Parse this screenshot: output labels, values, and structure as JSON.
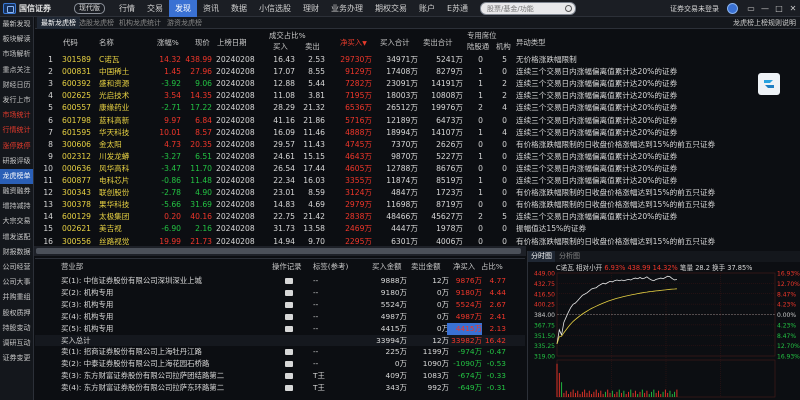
{
  "app": {
    "logo_text": "国信证券",
    "edition": "现代版",
    "menu": [
      "行情",
      "交易",
      "发现",
      "资讯",
      "数据",
      "小信选股",
      "理财",
      "业务办理",
      "期权交易",
      "账户",
      "E苏通"
    ],
    "active_menu_index": 2,
    "search_placeholder": "股票/基金/功能",
    "login_status": "证券交易未登录",
    "window_buttons": [
      "▭",
      "—",
      "□",
      "✕"
    ]
  },
  "sidebar": {
    "items": [
      "最新发现",
      "板块解读",
      "市场解析",
      "重点关注",
      "财经日历",
      "发行上市",
      "市场统计",
      "行情统计",
      "涨停跌停",
      "研报评级",
      "龙虎榜单",
      "融资融券",
      "增持减持",
      "大宗交易",
      "增发送配",
      "财报数据",
      "公司经营",
      "公司大事",
      "并购重组",
      "股权质押",
      "持股变动",
      "调研互动",
      "证券变更"
    ],
    "red_items": [
      6,
      7,
      8
    ],
    "active_index": 10
  },
  "subtabs": {
    "items": [
      "最新龙虎榜",
      "选股龙虎榜",
      "机构龙虎统计",
      "游资龙虎榜"
    ],
    "active_index": 0,
    "right_link": "龙虎榜上榜规则说明"
  },
  "grid": {
    "header_top": {
      "turnover_ratio": "成交占比%",
      "dedicated_seats": "专用席位"
    },
    "header": {
      "num": "",
      "code": "代码",
      "name": "名称",
      "change": "涨幅%",
      "price": "现价",
      "list_date": "上榜日期",
      "buy": "买入",
      "sell": "卖出",
      "net_buy": "净买入",
      "buy_total": "买入合计",
      "sell_total": "卖出合计",
      "hk_connect": "陆股通",
      "institution": "机构",
      "reason": "异动类型"
    },
    "rows": [
      {
        "num": "1",
        "code": "301589",
        "name": "C诺瓦",
        "change": "14.32",
        "price": "438.99",
        "date": "20240208",
        "buy": "16.43",
        "sell": "2.53",
        "net": "29730万",
        "buy_total": "34971万",
        "sell_total": "5241万",
        "hk": "0",
        "inst": "5",
        "reason": "无价格涨跌幅限制",
        "dir": "up"
      },
      {
        "num": "2",
        "code": "000831",
        "name": "中国稀土",
        "change": "1.45",
        "price": "27.96",
        "date": "20240208",
        "buy": "17.07",
        "sell": "8.55",
        "net": "9129万",
        "buy_total": "17408万",
        "sell_total": "8279万",
        "hk": "1",
        "inst": "0",
        "reason": "连续三个交易日内涨幅偏离值累计达20%的证券",
        "dir": "up"
      },
      {
        "num": "3",
        "code": "600392",
        "name": "盛和资源",
        "change": "-3.92",
        "price": "9.06",
        "date": "20240208",
        "buy": "12.88",
        "sell": "5.44",
        "net": "7282万",
        "buy_total": "23091万",
        "sell_total": "14191万",
        "hk": "1",
        "inst": "2",
        "reason": "连续三个交易日内涨幅偏离值累计达20%的证券",
        "dir": "down"
      },
      {
        "num": "4",
        "code": "002625",
        "name": "光启技术",
        "change": "3.54",
        "price": "14.35",
        "date": "20240208",
        "buy": "11.08",
        "sell": "3.81",
        "net": "7195万",
        "buy_total": "18003万",
        "sell_total": "10808万",
        "hk": "1",
        "inst": "2",
        "reason": "连续三个交易日内涨幅偏离值累计达20%的证券",
        "dir": "up"
      },
      {
        "num": "5",
        "code": "600557",
        "name": "康缘药业",
        "change": "-2.71",
        "price": "17.22",
        "date": "20240208",
        "buy": "28.29",
        "sell": "21.32",
        "net": "6536万",
        "buy_total": "26512万",
        "sell_total": "19976万",
        "hk": "2",
        "inst": "4",
        "reason": "连续三个交易日内涨幅偏离值累计达20%的证券",
        "dir": "down"
      },
      {
        "num": "6",
        "code": "601798",
        "name": "蓝科高新",
        "change": "9.97",
        "price": "6.84",
        "date": "20240208",
        "buy": "41.16",
        "sell": "21.86",
        "net": "5716万",
        "buy_total": "12189万",
        "sell_total": "6473万",
        "hk": "0",
        "inst": "0",
        "reason": "连续三个交易日内涨幅偏离值累计达20%的证券",
        "dir": "up"
      },
      {
        "num": "7",
        "code": "601595",
        "name": "华天科技",
        "change": "10.01",
        "price": "8.57",
        "date": "20240208",
        "buy": "16.09",
        "sell": "11.46",
        "net": "4888万",
        "buy_total": "18994万",
        "sell_total": "14107万",
        "hk": "1",
        "inst": "4",
        "reason": "连续三个交易日内涨幅偏离值累计达20%的证券",
        "dir": "up"
      },
      {
        "num": "8",
        "code": "300606",
        "name": "金太阳",
        "change": "4.73",
        "price": "20.35",
        "date": "20240208",
        "buy": "29.57",
        "sell": "11.43",
        "net": "4745万",
        "buy_total": "7370万",
        "sell_total": "2626万",
        "hk": "0",
        "inst": "0",
        "reason": "有价格涨跌幅限制的日收盘价格涨幅达到15%的前五只证券",
        "dir": "up"
      },
      {
        "num": "9",
        "code": "002312",
        "name": "川发龙蟒",
        "change": "-3.27",
        "price": "6.51",
        "date": "20240208",
        "buy": "24.61",
        "sell": "15.15",
        "net": "4643万",
        "buy_total": "9870万",
        "sell_total": "5227万",
        "hk": "1",
        "inst": "0",
        "reason": "连续三个交易日内涨幅偏离值累计达20%的证券",
        "dir": "down"
      },
      {
        "num": "10",
        "code": "000636",
        "name": "风华高科",
        "change": "-3.47",
        "price": "11.70",
        "date": "20240208",
        "buy": "26.54",
        "sell": "17.44",
        "net": "4605万",
        "buy_total": "12788万",
        "sell_total": "8676万",
        "hk": "0",
        "inst": "0",
        "reason": "连续三个交易日内涨幅偏离值累计达20%的证券",
        "dir": "down"
      },
      {
        "num": "11",
        "code": "600877",
        "name": "电科芯片",
        "change": "-0.86",
        "price": "11.48",
        "date": "20240208",
        "buy": "22.34",
        "sell": "16.03",
        "net": "3355万",
        "buy_total": "11874万",
        "sell_total": "8519万",
        "hk": "1",
        "inst": "0",
        "reason": "连续三个交易日内涨幅偏离值累计达20%的证券",
        "dir": "down"
      },
      {
        "num": "12",
        "code": "300343",
        "name": "联创股份",
        "change": "-2.78",
        "price": "4.90",
        "date": "20240208",
        "buy": "23.01",
        "sell": "8.59",
        "net": "3124万",
        "buy_total": "4847万",
        "sell_total": "1723万",
        "hk": "1",
        "inst": "0",
        "reason": "有价格涨跌幅限制的日收盘价格涨幅达到15%的前五只证券",
        "dir": "down"
      },
      {
        "num": "13",
        "code": "300378",
        "name": "果华科技",
        "change": "-5.66",
        "price": "31.69",
        "date": "20240208",
        "buy": "14.83",
        "sell": "4.69",
        "net": "2979万",
        "buy_total": "11698万",
        "sell_total": "8719万",
        "hk": "0",
        "inst": "0",
        "reason": "有价格涨跌幅限制的日收盘价格涨幅达到15%的前五只证券",
        "dir": "down"
      },
      {
        "num": "14",
        "code": "600129",
        "name": "太极集团",
        "change": "0.20",
        "price": "40.16",
        "date": "20240208",
        "buy": "22.75",
        "sell": "21.42",
        "net": "2838万",
        "buy_total": "48466万",
        "sell_total": "45627万",
        "hk": "2",
        "inst": "5",
        "reason": "连续三个交易日内涨幅偏离值累计达20%的证券",
        "dir": "up"
      },
      {
        "num": "15",
        "code": "002621",
        "name": "美吉视",
        "change": "-6.90",
        "price": "2.16",
        "date": "20240208",
        "buy": "31.73",
        "sell": "13.58",
        "net": "2469万",
        "buy_total": "4447万",
        "sell_total": "1978万",
        "hk": "0",
        "inst": "0",
        "reason": "振幅值达15%的证券",
        "dir": "down"
      },
      {
        "num": "16",
        "code": "300556",
        "name": "丝路视觉",
        "change": "19.99",
        "price": "21.73",
        "date": "20240208",
        "buy": "14.94",
        "sell": "9.70",
        "net": "2295万",
        "buy_total": "6301万",
        "sell_total": "4006万",
        "hk": "0",
        "inst": "0",
        "reason": "有价格涨跌幅限制的日收盘价格涨幅达到15%的前五只证券",
        "dir": "up"
      },
      {
        "num": "17",
        "code": "601127",
        "name": "赛力斯",
        "change": "3.42",
        "price": "74.15",
        "date": "20240208",
        "buy": "12.59",
        "sell": "12.43",
        "net": "2224万",
        "buy_total": "180993万",
        "sell_total": "178770万",
        "hk": "2",
        "inst": "5",
        "reason": "连续三个交易日内涨幅偏离值累计达20%的证券",
        "dir": "up"
      }
    ]
  },
  "lower": {
    "header": {
      "dept": "营业部",
      "record": "操作记录",
      "tag": "标签(参考)",
      "buy_amt": "买入金额",
      "sell_amt": "卖出金额",
      "net": "净买入",
      "ratio": "占比%"
    },
    "rows": [
      {
        "dept": "买(1): 中信证券股份有限公司深圳深业上城",
        "record": true,
        "tag": "--",
        "buy": "9888万",
        "sell": "12万",
        "net": "9876万",
        "ratio": "4.77",
        "dir": "up",
        "highlight": false
      },
      {
        "dept": "买(2): 机构专用",
        "record": true,
        "tag": "--",
        "buy": "9180万",
        "sell": "0万",
        "net": "9180万",
        "ratio": "4.44",
        "dir": "up",
        "highlight": false
      },
      {
        "dept": "买(3): 机构专用",
        "record": true,
        "tag": "--",
        "buy": "5524万",
        "sell": "0万",
        "net": "5524万",
        "ratio": "2.67",
        "dir": "up",
        "highlight": false
      },
      {
        "dept": "买(4): 机构专用",
        "record": true,
        "tag": "--",
        "buy": "4987万",
        "sell": "0万",
        "net": "4987万",
        "ratio": "2.41",
        "dir": "up",
        "highlight": false
      },
      {
        "dept": "买(5): 机构专用",
        "record": true,
        "tag": "--",
        "buy": "4415万",
        "sell": "0万",
        "net": "4415万",
        "ratio": "2.13",
        "dir": "up",
        "highlight": true
      },
      {
        "dept": "买入总计",
        "record": false,
        "tag": "",
        "buy": "33994万",
        "sell": "12万",
        "net": "33982万",
        "ratio": "16.42",
        "dir": "up",
        "highlight": false,
        "sum": true
      },
      {
        "dept": "卖(1): 招商证券股份有限公司上海牡丹江路",
        "record": true,
        "tag": "--",
        "buy": "225万",
        "sell": "1199万",
        "net": "-974万",
        "ratio": "-0.47",
        "dir": "down",
        "highlight": false
      },
      {
        "dept": "卖(2): 中泰证券股份有限公司上海花园石桥路",
        "record": true,
        "tag": "--",
        "buy": "0万",
        "sell": "1090万",
        "net": "-1090万",
        "ratio": "-0.53",
        "dir": "down",
        "highlight": false
      },
      {
        "dept": "卖(3): 东方财富证券股份有限公司拉萨团结路第二",
        "record": true,
        "tag": "T王",
        "buy": "409万",
        "sell": "1083万",
        "net": "-674万",
        "ratio": "-0.33",
        "dir": "down",
        "highlight": false
      },
      {
        "dept": "卖(4): 东方财富证券股份有限公司拉萨东环路第二",
        "record": true,
        "tag": "T王",
        "buy": "343万",
        "sell": "992万",
        "net": "-649万",
        "ratio": "-0.31",
        "dir": "down",
        "highlight": false
      }
    ]
  },
  "chart": {
    "tabs": [
      "分时图",
      "分析图"
    ],
    "active_tab": 0,
    "stock_name": "C诺瓦",
    "price_label": "相对小开",
    "price": "6.93%",
    "last": "438.99",
    "change_pct": "14.32%",
    "volume_label": "笔量",
    "volume": "28.2",
    "turnover_label": "换手",
    "turnover": "37.85%",
    "left_axis": [
      "449.00",
      "432.75",
      "416.50",
      "400.25",
      "384.00",
      "367.75",
      "351.50",
      "335.25",
      "319.00",
      "",
      "",
      ""
    ],
    "right_axis": [
      "16.93%",
      "12.70%",
      "8.47%",
      "4.23%",
      "0.00%",
      "4.23%",
      "8.47%",
      "12.70%",
      "16.93%"
    ]
  },
  "chart_data": {
    "type": "line",
    "title": "",
    "xlabel": "",
    "ylabel": "",
    "ylim": [
      319.0,
      449.0
    ],
    "series": [
      {
        "values": [
          338,
          360,
          352,
          372,
          380,
          388,
          395,
          400,
          402,
          406,
          410,
          414,
          416,
          418,
          421,
          424,
          425,
          426,
          429,
          431,
          433,
          432,
          434,
          436,
          435,
          437,
          438,
          437,
          438,
          437,
          438,
          439,
          438,
          440,
          441,
          440,
          442,
          440,
          441,
          443,
          440,
          438,
          437,
          439,
          440,
          441,
          440,
          442,
          444,
          443,
          440,
          438,
          439
        ]
      }
    ],
    "colors": {
      "price": "#e8e8e8",
      "avg": "#e8d243",
      "volume_up": "#f0362a",
      "volume_down": "#23c343"
    }
  }
}
